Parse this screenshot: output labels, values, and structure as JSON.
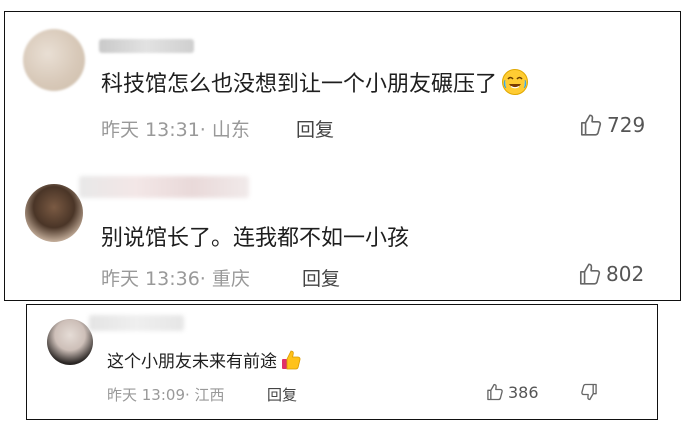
{
  "comments": [
    {
      "name_partial": "婚礼妈妈",
      "text": "科技馆怎么也没想到让一个小朋友碾压了",
      "emoji": "laughing-crying-emoji",
      "time": "昨天 13:31· 山东",
      "reply_label": "回复",
      "likes": "729"
    },
    {
      "text": "别说馆长了。连我都不如一小孩",
      "time": "昨天 13:36· 重庆",
      "reply_label": "回复",
      "likes": "802"
    },
    {
      "text": "这个小朋友未来有前途",
      "emoji": "thumbs-up-emoji",
      "time": "昨天 13:09· 江西",
      "reply_label": "回复",
      "likes": "386",
      "dislike_icon": "thumbs-down-icon"
    }
  ],
  "icons": {
    "like": "thumbs-up-outline-icon"
  },
  "colors": {
    "border": "#111111",
    "meta_text": "#999999",
    "body_text": "#1e1e1e"
  }
}
